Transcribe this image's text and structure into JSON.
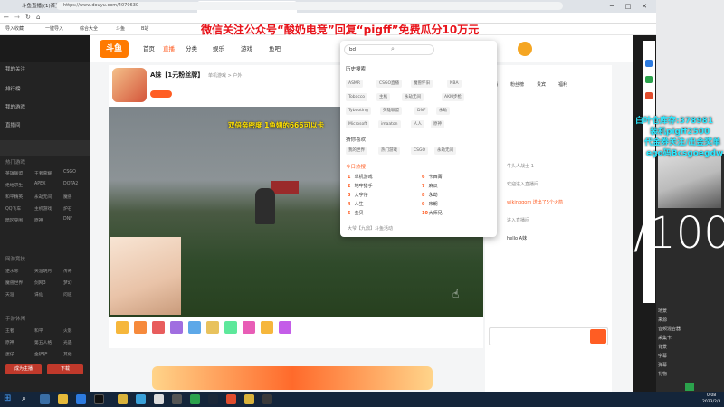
{
  "browser": {
    "tabs": [
      "斗鱼直播|(1)首页",
      "工作台 | 首页",
      "A妹【1元粉丝牌】单机游戏直播"
    ],
    "url": "https://www.douyu.com/4070630",
    "bookmarks": [
      "导入收藏",
      "一键导入",
      "综合大全",
      "斗鱼",
      "B站"
    ]
  },
  "banner": "微信关注公众号“酸奶电竞”回复“pigff”免费瓜分10万元",
  "douyu": {
    "logo": "斗鱼",
    "nav": [
      "首页",
      "直播",
      "分类",
      "娱乐",
      "游戏",
      "鱼吧"
    ],
    "search_placeholder": "bd",
    "streamer_name": "A妹【1元粉丝牌】",
    "room_label": "单机游戏 > 户外"
  },
  "sidebar": {
    "items": [
      "我的关注",
      "排行榜",
      "我的游戏",
      "直播间"
    ],
    "sec1": "热门游戏",
    "grid1": [
      [
        "英雄联盟",
        "王者荣耀",
        "CSGO"
      ],
      [
        "绝地求生",
        "APEX",
        "DOTA2"
      ],
      [
        "和平精英",
        "永劫无间",
        "魔兽"
      ],
      [
        "QQ飞车",
        "主机游戏",
        "炉石"
      ],
      [
        "暗区突围",
        "原神",
        "DNF"
      ]
    ],
    "sec2": "网游竞技",
    "grid2": [
      [
        "逆水寒",
        "天涯明月",
        "传奇"
      ],
      [
        "魔兽世界",
        "剑网3",
        "梦幻"
      ],
      [
        "天涯",
        "诛仙",
        "问道"
      ]
    ],
    "sec3": "手游休闲",
    "grid3": [
      [
        "王者",
        "和平",
        "火影"
      ],
      [
        "原神",
        "第五人格",
        "光遇"
      ],
      [
        "蛋仔",
        "金铲铲",
        "其他"
      ]
    ],
    "btn_a": "成为主播",
    "btn_b": "下载"
  },
  "video": {
    "danmu": "双倍亲密度 1鱼翅的666可以卡"
  },
  "search_drop": {
    "history_title": "历史搜索",
    "history": [
      [
        "ASMR",
        "CSGO直播",
        "魔兽怀旧",
        "NBA"
      ],
      [
        "Tobacco",
        "主机",
        "永劫无间",
        "AKM步枪"
      ],
      [
        "Tybooting",
        "英雄联盟",
        "DNF",
        "永劫"
      ],
      [
        "Microsoft",
        "imaaton",
        "人人",
        "原神"
      ]
    ],
    "guess_title": "猜你喜欢",
    "guess": [
      [
        "我的世界",
        "热门游戏",
        "CSGO",
        "永劫无间"
      ]
    ],
    "hot_title": "今日热搜",
    "hot": [
      [
        "1",
        "单机游戏"
      ],
      [
        "2",
        "地牢猎手"
      ],
      [
        "3",
        "大字仔"
      ],
      [
        "4",
        "人生"
      ],
      [
        "5",
        "金贝"
      ],
      [
        "6",
        "卡西菁"
      ],
      [
        "7",
        "麻瓜"
      ],
      [
        "8",
        "永劫"
      ],
      [
        "9",
        "宋朝"
      ],
      [
        "10",
        "大师兄"
      ]
    ],
    "footer": "大爷【九鼎】斗鱼活动"
  },
  "right": {
    "tabs": [
      "主播",
      "粉丝榜",
      "贵宾",
      "福利"
    ],
    "chat": [
      "牛头人战士-1",
      "欢迎进入直播间",
      "wikinggom 送出了5个火箭",
      "进入直播间",
      "hello A妹"
    ]
  },
  "obs": {
    "cyan1": "白叶仓库存:378981",
    "cyan2": "装机pigff2500",
    "cyan3": "代金券关注/出金奖单",
    "cyan4": "ego码Bcsgoegdw",
    "counter": "/100",
    "rows": [
      "场景",
      "来源",
      "音频混合器",
      "采集卡",
      "背景",
      "字幕",
      "弹幕",
      "礼物"
    ]
  },
  "taskbar": {
    "time": "0:08",
    "date": "2023/2/3"
  }
}
